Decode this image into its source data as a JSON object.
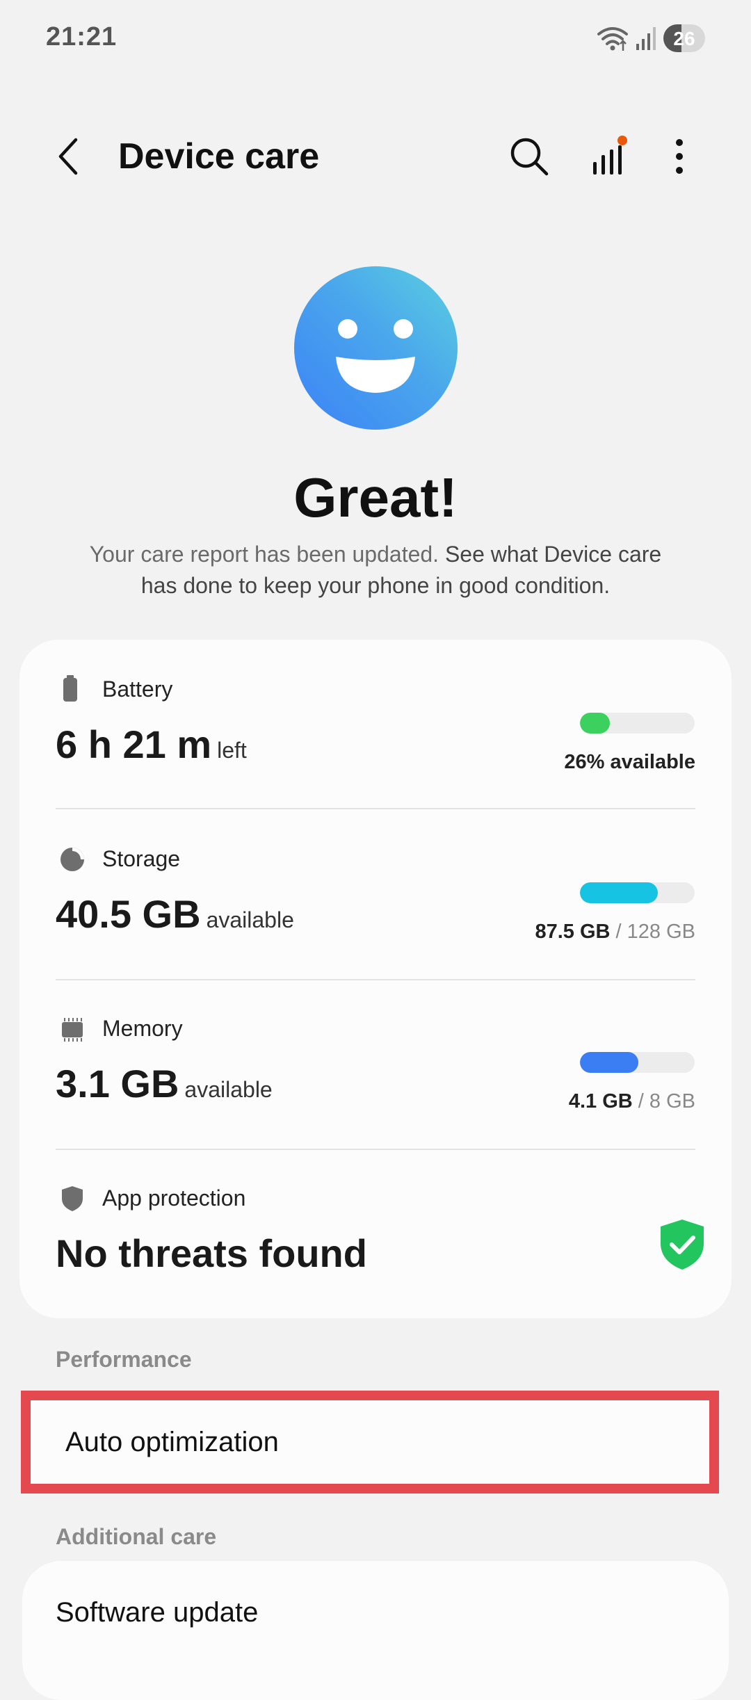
{
  "status_bar": {
    "time": "21:21",
    "battery_level": "26"
  },
  "header": {
    "title": "Device care",
    "back_icon": "chevron-left-icon",
    "search_icon": "search-icon",
    "report_icon": "signal-bars-icon",
    "more_icon": "more-vertical-icon",
    "notification_dot_color": "#ea580c"
  },
  "hero": {
    "title": "Great!",
    "description_part1": "Your care report has been updated.",
    "description_part2": "See what Device care has done to keep your phone in good condition."
  },
  "status_card": {
    "battery": {
      "label": "Battery",
      "value": "6 h 21 m",
      "unit": "left",
      "caption": "26% available",
      "level_percent": 26,
      "color": "#3cd15f"
    },
    "storage": {
      "label": "Storage",
      "value": "40.5 GB",
      "unit": "available",
      "used": "87.5 GB",
      "sep": "/",
      "total": "128 GB",
      "level_percent": 68,
      "color": "#16c3e3"
    },
    "memory": {
      "label": "Memory",
      "value": "3.1 GB",
      "unit": "available",
      "used": "4.1 GB",
      "sep": "/",
      "total": "8 GB",
      "level_percent": 51,
      "color": "#3b7df2"
    },
    "app_protection": {
      "label": "App protection",
      "value": "No threats found",
      "color": "#22c55e"
    }
  },
  "performance": {
    "header": "Performance",
    "auto_optimization": "Auto optimization",
    "highlight_color": "#e4494f"
  },
  "additional_care": {
    "header": "Additional care",
    "software_update": "Software update"
  }
}
